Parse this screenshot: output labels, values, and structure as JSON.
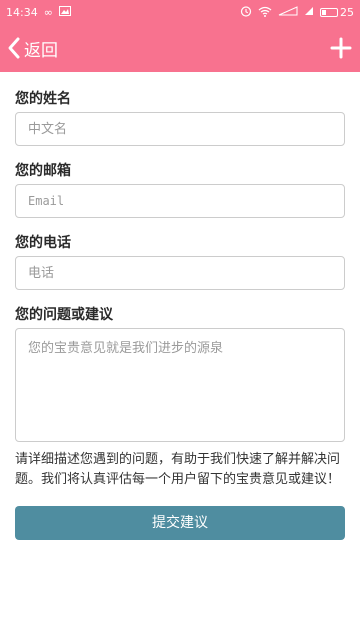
{
  "status_bar": {
    "time": "14:34",
    "battery_level": "25",
    "signal_text": "4G"
  },
  "header": {
    "back_label": "返回",
    "add_icon": "plus-icon"
  },
  "form": {
    "name_label": "您的姓名",
    "name_placeholder": "中文名",
    "email_label": "您的邮箱",
    "email_placeholder": "Email",
    "phone_label": "您的电话",
    "phone_placeholder": "电话",
    "feedback_label": "您的问题或建议",
    "feedback_placeholder": "您的宝贵意见就是我们进步的源泉",
    "hint": "请详细描述您遇到的问题，有助于我们快速了解并解决问题。我们将认真评估每一个用户留下的宝贵意见或建议！",
    "submit_label": "提交建议"
  },
  "colors": {
    "accent": "#f8728f",
    "button": "#4f8da0"
  }
}
